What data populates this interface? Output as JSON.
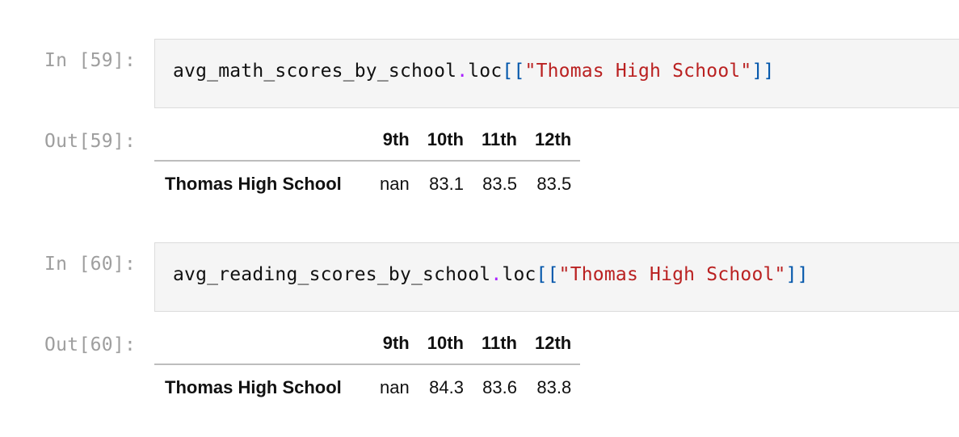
{
  "cells": [
    {
      "in_prompt": "In [59]:",
      "out_prompt": "Out[59]:",
      "code": {
        "obj": "avg_math_scores_by_school",
        "dot": ".",
        "method": "loc",
        "open": "[[",
        "string": "\"Thomas High School\"",
        "close": "]]"
      },
      "table": {
        "columns": [
          "9th",
          "10th",
          "11th",
          "12th"
        ],
        "index": "Thomas High School",
        "values": [
          "nan",
          "83.1",
          "83.5",
          "83.5"
        ]
      }
    },
    {
      "in_prompt": "In [60]:",
      "out_prompt": "Out[60]:",
      "code": {
        "obj": "avg_reading_scores_by_school",
        "dot": ".",
        "method": "loc",
        "open": "[[",
        "string": "\"Thomas High School\"",
        "close": "]]"
      },
      "table": {
        "columns": [
          "9th",
          "10th",
          "11th",
          "12th"
        ],
        "index": "Thomas High School",
        "values": [
          "nan",
          "84.3",
          "83.6",
          "83.8"
        ]
      }
    }
  ],
  "colors": {
    "prompt": "#9e9e9e",
    "operator": "#aa22ff",
    "bracket": "#0055aa",
    "string": "#ba2121",
    "input_bg": "#f5f5f5"
  }
}
